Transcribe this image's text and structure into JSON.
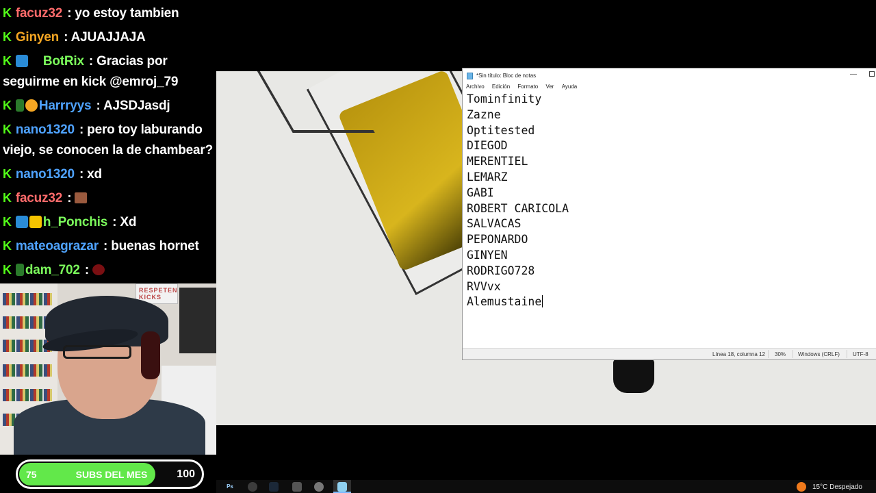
{
  "chat": {
    "messages": [
      {
        "user": "facuz32",
        "user_color": "#ff6b6b",
        "separator": " : ",
        "text": "yo estoy tambien",
        "badges": []
      },
      {
        "user": "Ginyen",
        "user_color": "#f5a623",
        "separator": " : ",
        "text": "AJUAJJAJA",
        "badges": []
      },
      {
        "user": "BotRix",
        "user_color": "#7cfc5c",
        "separator": " : ",
        "text": "Gracias por seguirme en kick @emroj_79",
        "badges": [
          "sub",
          "verified"
        ]
      },
      {
        "user": "Harrryys",
        "user_color": "#4fa3ff",
        "separator": " : ",
        "text": "AJSDJasdj",
        "badges": [
          "og",
          "gift"
        ]
      },
      {
        "user": "nano1320",
        "user_color": "#4fa3ff",
        "separator": " : ",
        "text": "pero toy laburando viejo, se conocen la de chambear?",
        "badges": []
      },
      {
        "user": "nano1320",
        "user_color": "#4fa3ff",
        "separator": " : ",
        "text": "xd",
        "badges": []
      },
      {
        "user": "facuz32",
        "user_color": "#ff6b6b",
        "separator": " : ",
        "text": "",
        "badges": [],
        "emote": "emote"
      },
      {
        "user": "h_Ponchis",
        "user_color": "#7cfc5c",
        "separator": " : ",
        "text": "Xd",
        "badges": [
          "sub",
          "crown"
        ]
      },
      {
        "user": "mateoagrazar",
        "user_color": "#4fa3ff",
        "separator": " : ",
        "text": "buenas hornet",
        "badges": []
      },
      {
        "user": "dam_702",
        "user_color": "#7cfc5c",
        "separator": " : ",
        "text": "",
        "badges": [
          "og"
        ],
        "emote": "red-emote"
      }
    ]
  },
  "webcam": {
    "poster_text": "RESPETEN KICKS"
  },
  "subs_goal": {
    "current": "75",
    "label": "SUBS DEL MES",
    "target": "100",
    "progress_fraction": 0.75,
    "fill_color": "#62e84a"
  },
  "notepad": {
    "title": "*Sin título: Bloc de notas",
    "menu": [
      "Archivo",
      "Edición",
      "Formato",
      "Ver",
      "Ayuda"
    ],
    "lines": [
      "Tominfinity",
      "Zazne",
      "Optitested",
      "DIEGOD",
      "MERENTIEL",
      "LEMARZ",
      "GABI",
      "ROBERT CARICOLA",
      "SALVACAS",
      "PEPONARDO",
      "GINYEN",
      "RODRIGO728",
      "RVVvx",
      "Alemustaine"
    ],
    "status": {
      "position": "Línea 18, columna 12",
      "zoom": "30%",
      "line_ending": "Windows (CRLF)",
      "encoding": "UTF-8"
    }
  },
  "taskbar": {
    "icons": [
      "photoshop-icon",
      "chrome-icon",
      "steam-icon",
      "app-icon",
      "settings-icon",
      "notepad-icon"
    ],
    "photoshop_label": "Ps",
    "weather_text": "15°C  Despejado"
  }
}
